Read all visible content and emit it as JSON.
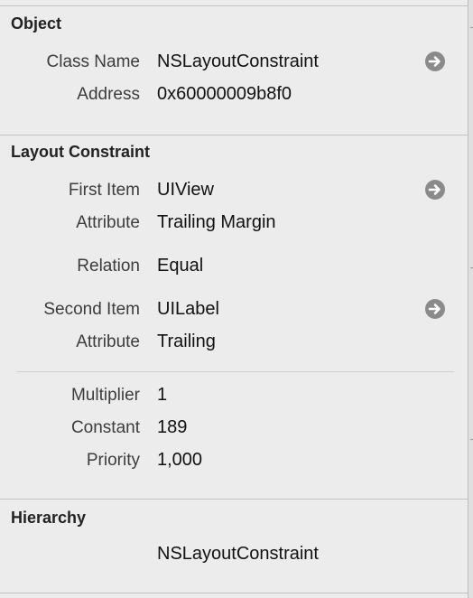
{
  "object_section": {
    "title": "Object",
    "class_name_label": "Class Name",
    "class_name_value": "NSLayoutConstraint",
    "address_label": "Address",
    "address_value": "0x60000009b8f0"
  },
  "layout_constraint_section": {
    "title": "Layout Constraint",
    "first_item_label": "First Item",
    "first_item_value": "UIView",
    "first_attribute_label": "Attribute",
    "first_attribute_value": "Trailing Margin",
    "relation_label": "Relation",
    "relation_value": "Equal",
    "second_item_label": "Second Item",
    "second_item_value": "UILabel",
    "second_attribute_label": "Attribute",
    "second_attribute_value": "Trailing",
    "multiplier_label": "Multiplier",
    "multiplier_value": "1",
    "constant_label": "Constant",
    "constant_value": "189",
    "priority_label": "Priority",
    "priority_value": "1,000"
  },
  "hierarchy_section": {
    "title": "Hierarchy",
    "value": "NSLayoutConstraint"
  },
  "icons": {
    "navigate_arrow": "arrow-right-circle-icon"
  }
}
